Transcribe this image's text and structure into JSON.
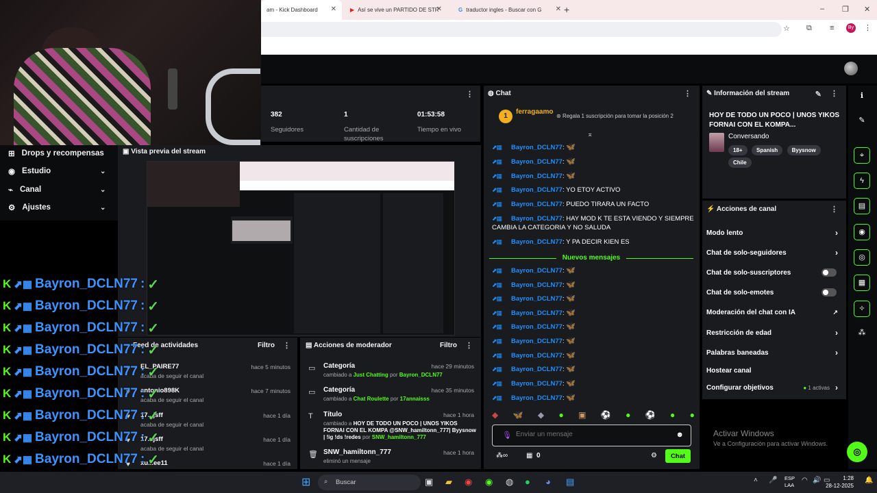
{
  "browser": {
    "tabs": [
      {
        "label": "am - Kick Dashboard"
      },
      {
        "label": "Así se vive un PARTIDO DE STR"
      },
      {
        "label": "traductor ingles - Buscar con G"
      }
    ],
    "new_tab": "+",
    "window_min": "–",
    "window_max": "❐",
    "window_close": "✕",
    "profile_initial": "By"
  },
  "stats": {
    "followers_value": "382",
    "followers_label": "Seguidores",
    "subs_value": "1",
    "subs_label": "Cantidad de suscripciones",
    "uptime_value": "01:53:58",
    "uptime_label": "Tiempo en vivo"
  },
  "nav": {
    "items": [
      {
        "label": "Drops y recompensas"
      },
      {
        "label": "Estudio"
      },
      {
        "label": "Canal"
      },
      {
        "label": "Ajustes"
      }
    ]
  },
  "preview": {
    "title": "Vista previa del stream"
  },
  "feed": {
    "title": "Feed de actividades",
    "filter": "Filtro",
    "items": [
      {
        "user": "EL_PAIRE77",
        "action": "acaba de seguir el canal",
        "time": "hace 5 minutos"
      },
      {
        "user": "antonio898K",
        "action": "acaba de seguir el canal",
        "time": "hace 7 minutos"
      },
      {
        "user": "17...jsff",
        "action": "acaba de seguir el canal",
        "time": "hace 1 día"
      },
      {
        "user": "17...jsff",
        "action": "acaba de seguir el canal",
        "time": "hace 1 día"
      },
      {
        "user": "xu...ee11",
        "action": "",
        "time": "hace 1 día"
      }
    ]
  },
  "mod": {
    "title": "Acciones de moderador",
    "filter": "Filtro",
    "items": [
      {
        "title": "Categoría",
        "pre": "cambiado a",
        "value": "Just Chatting",
        "by": "por",
        "who": "Bayron_DCLN77",
        "time": "hace 29 minutos"
      },
      {
        "title": "Categoría",
        "pre": "cambiado a",
        "value": "Chat Roulette",
        "by": "por",
        "who": "17annaisss",
        "time": "hace 35 minutos"
      },
      {
        "title": "Título",
        "pre": "cambiado a",
        "value": "HOY DE TODO UN POCO | UNOS YIKOS FORNAI CON EL KOMPA @SNW_hamiltonn_777| Byysnow | !ig !ds !redes",
        "by": "por",
        "who": "SNW_hamiltonn_777",
        "time": "hace 1 hora"
      },
      {
        "title": "SNW_hamiltonn_777",
        "pre": "eliminó un mensaje",
        "value": "",
        "by": "",
        "who": "",
        "time": "hace 1 hora"
      }
    ]
  },
  "chat": {
    "title": "Chat",
    "pinned_user": "ferragaamo",
    "pinned_rank": "1",
    "pinned_text": "Regala 1 suscripción para tomar la posición 2",
    "messages_before": [
      {
        "user": "Bayron_DCLN77",
        "text": ""
      },
      {
        "user": "Bayron_DCLN77",
        "text": ""
      },
      {
        "user": "Bayron_DCLN77",
        "text": ""
      },
      {
        "user": "Bayron_DCLN77",
        "text": "YO ETOY ACTIVO"
      },
      {
        "user": "Bayron_DCLN77",
        "text": "PUEDO TIRARA UN FACTO"
      },
      {
        "user": "Bayron_DCLN77",
        "text": "HAY MOD K TE ESTA VIENDO Y SIEMPRE CAMBIA LA CATEGORIA Y NO SALUDA"
      },
      {
        "user": "Bayron_DCLN77",
        "text": "Y PA DECIR KIEN ES"
      }
    ],
    "new_messages_label": "Nuevos mensajes",
    "messages_after_user": "Bayron_DCLN77",
    "input_placeholder": "Enviar un mensaje",
    "points": "0",
    "send_label": "Chat"
  },
  "info": {
    "title": "Información del stream",
    "stream_title": "HOY DE TODO UN POCO | UNOS YIKOS FORNAI CON EL KOMPA...",
    "category": "Conversando",
    "tags": [
      "18+",
      "Spanish",
      "Byysnow",
      "Chile"
    ]
  },
  "actions": {
    "title": "Acciones de canal",
    "items": [
      {
        "label": "Modo lento"
      },
      {
        "label": "Chat de solo-seguidores"
      },
      {
        "label": "Chat de solo-suscriptores"
      },
      {
        "label": "Chat de solo-emotes"
      },
      {
        "label": "Moderación del chat con IA"
      },
      {
        "label": "Restricción de edad"
      },
      {
        "label": "Palabras baneadas"
      },
      {
        "label": "Hostear canal"
      },
      {
        "label": "Configurar objetivos"
      }
    ],
    "goals_active": "1 activas"
  },
  "windows_notice": {
    "title": "Activar Windows",
    "subtitle": "Ve a Configuración para activar Windows."
  },
  "overlay": {
    "user": "Bayron_DCLN77",
    "separator": ":"
  },
  "taskbar": {
    "search_placeholder": "Buscar",
    "lang": "ESP",
    "lang2": "LAA",
    "time": "1:28",
    "date": "28-12-2025"
  },
  "colors": {
    "accent": "#53fc18",
    "username": "#1e90ff",
    "panel": "#191b1f",
    "background": "#000000"
  }
}
